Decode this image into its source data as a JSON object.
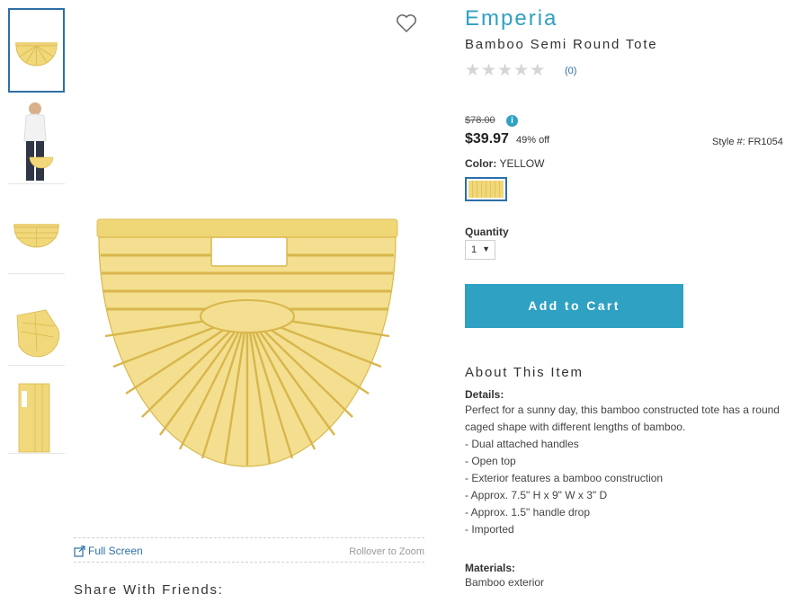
{
  "product": {
    "brand": "Emperia",
    "name": "Bamboo Semi Round Tote",
    "reviews": "(0)",
    "rating_stars": 0,
    "original_price": "$78.00",
    "sale_price": "$39.97",
    "discount": "49% off",
    "style_number": "Style #: FR1054",
    "color_label": "Color:",
    "color_value": "YELLOW",
    "swatch_color": "#f1d87a",
    "quantity_label": "Quantity",
    "quantity_value": "1",
    "add_to_cart": "Add to Cart"
  },
  "gallery": {
    "full_screen": "Full Screen",
    "rollover": "Rollover to Zoom",
    "thumbnails": [
      "bag-front",
      "model-holding-bag",
      "bag-front-small",
      "bag-angle",
      "bag-side"
    ]
  },
  "share": {
    "title": "Share With Friends:"
  },
  "about": {
    "title": "About This Item",
    "details_label": "Details:",
    "details_text": "Perfect for a sunny day, this bamboo constructed tote has a round caged shape with different lengths of bamboo.",
    "bullets": [
      "- Dual attached handles",
      "- Open top",
      "- Exterior features a bamboo construction",
      "- Approx. 7.5\" H x 9\" W x 3\" D",
      "- Approx. 1.5\" handle drop",
      "- Imported"
    ],
    "materials_label": "Materials:",
    "materials_text": "Bamboo exterior"
  },
  "colors": {
    "accent": "#2fa1c2",
    "link": "#2d6fa6",
    "bamboo": "#f1d87a"
  }
}
